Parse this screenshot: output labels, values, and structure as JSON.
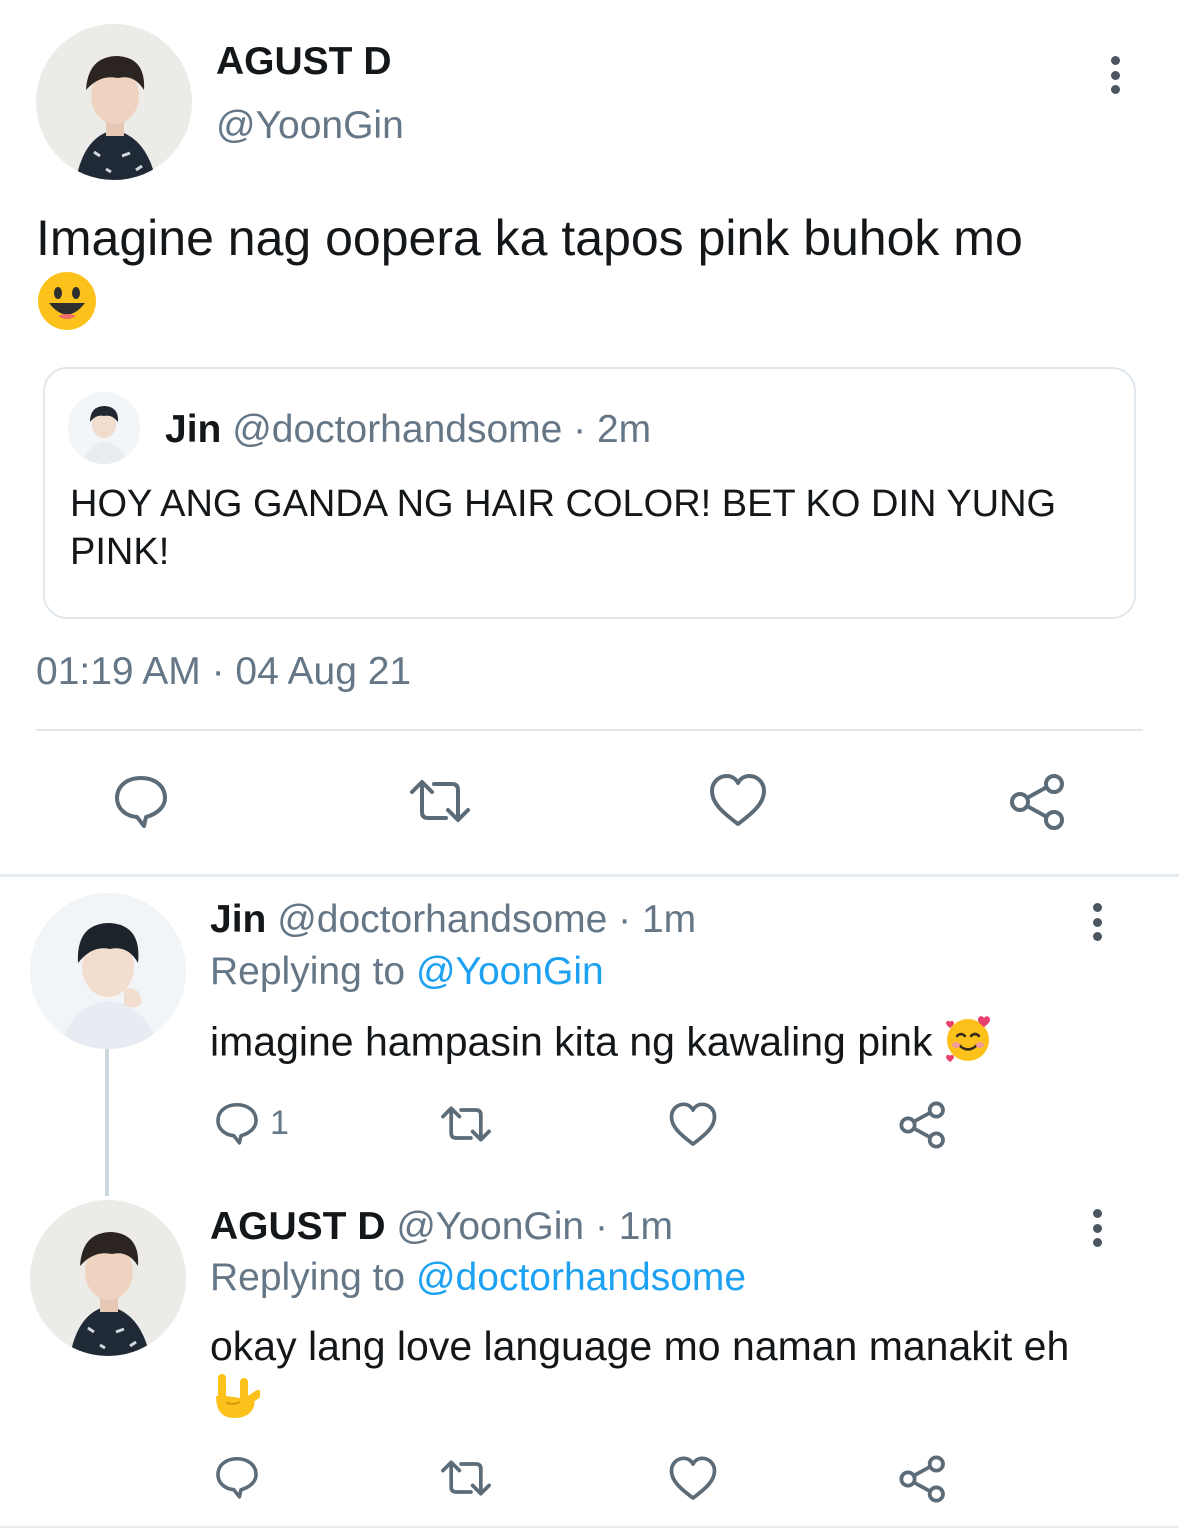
{
  "main_tweet": {
    "display_name": "AGUST D",
    "handle": "@YoonGin",
    "text": "Imagine nag oopera ka tapos pink buhok mo",
    "emoji": "smiley-face",
    "timestamp": "01:19 AM · 04 Aug 21",
    "quote": {
      "display_name": "Jin",
      "handle": "@doctorhandsome",
      "time": "· 2m",
      "text": "HOY ANG GANDA NG HAIR COLOR! BET KO DIN YUNG PINK!"
    },
    "actions": [
      "reply-icon",
      "retweet-icon",
      "like-icon",
      "share-icon"
    ]
  },
  "replies": [
    {
      "display_name": "Jin",
      "handle": "@doctorhandsome",
      "time": "· 1m",
      "replying_prefix": "Replying to",
      "replying_to": "@YoonGin",
      "text": "imagine hampasin kita ng kawaling pink",
      "emoji": "smiling-face-with-hearts",
      "reply_count": "1"
    },
    {
      "display_name": "AGUST D",
      "handle": "@YoonGin",
      "time": "· 1m",
      "replying_prefix": "Replying to",
      "replying_to": "@doctorhandsome",
      "text": "okay lang love language mo naman manakit eh",
      "emoji": "love-you-gesture-hand",
      "reply_count": ""
    }
  ],
  "colors": {
    "text": "#14171a",
    "muted": "#657786",
    "link": "#1da1f2",
    "icon": "#5b6b78",
    "divider": "#e1e8ed"
  }
}
